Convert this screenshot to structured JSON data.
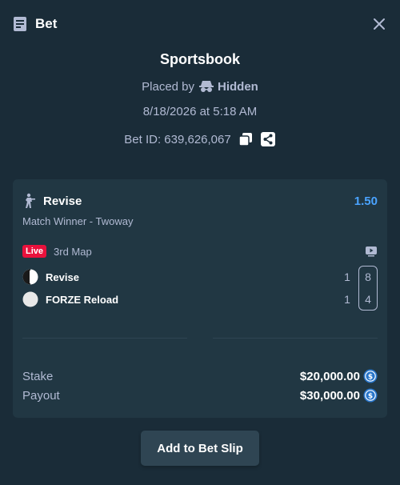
{
  "header": {
    "title": "Bet"
  },
  "bet": {
    "title": "Sportsbook",
    "placed_by_label": "Placed by",
    "placed_by_user": "Hidden",
    "date": "8/18/2026 at 5:18 AM",
    "bet_id": "Bet ID: 639,626,067"
  },
  "selection": {
    "name": "Revise",
    "odds": "1.50",
    "market": "Match Winner - Twoway",
    "live_label": "Live",
    "map": "3rd Map",
    "teams": [
      {
        "name": "Revise",
        "score_a": "1",
        "score_b": "8"
      },
      {
        "name": "FORZE Reload",
        "score_a": "1",
        "score_b": "4"
      }
    ]
  },
  "summary": {
    "stake_label": "Stake",
    "stake_value": "$20,000.00",
    "payout_label": "Payout",
    "payout_value": "$30,000.00"
  },
  "actions": {
    "add_to_slip": "Add to Bet Slip"
  },
  "colors": {
    "background": "#1a2c38",
    "card": "#213743",
    "accent_odds": "#4aa3ff",
    "live": "#e9113c",
    "button": "#2f4553"
  },
  "icons": {
    "header": "bet-slip-icon",
    "close": "close-icon",
    "hidden_user": "incognito-icon",
    "copy": "copy-icon",
    "share": "share-icon",
    "sport": "cs-player-icon",
    "stream": "tv-icon",
    "currency": "usd-coin-icon"
  }
}
